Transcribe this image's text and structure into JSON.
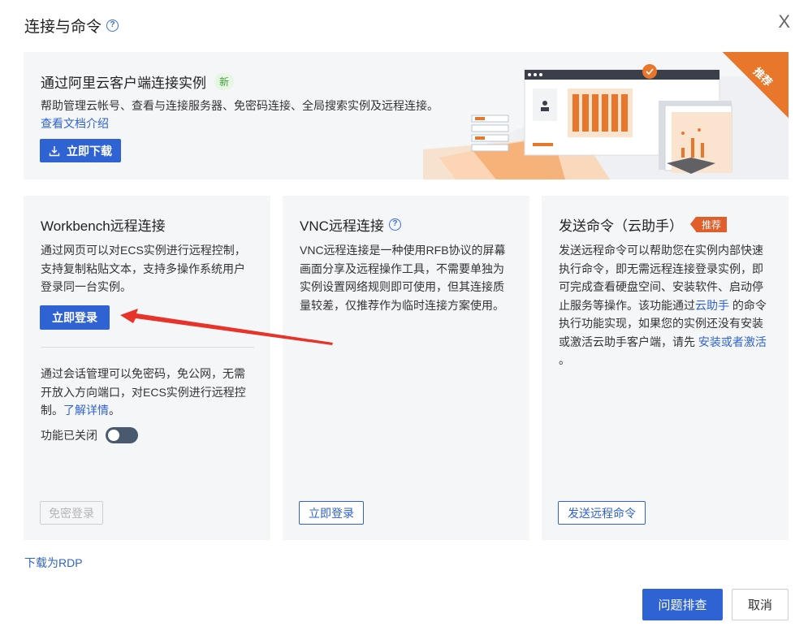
{
  "dialog": {
    "title": "连接与命令",
    "close_glyph": "X"
  },
  "banner": {
    "title": "通过阿里云客户端连接实例",
    "badge": "新",
    "description": "帮助管理云帐号、查看与连接服务器、免密码连接、全局搜索实例及远程连接。",
    "doc_link": "查看文档介绍",
    "download_button": "立即下载",
    "ribbon": "推荐"
  },
  "workbench": {
    "title": "Workbench远程连接",
    "description": "通过网页可以对ECS实例进行远程控制，支持复制粘贴文本，支持多操作系统用户登录同一台实例。",
    "login_button": "立即登录",
    "session_text": "通过会话管理可以免密码，免公网，无需开放入方向端口，对ECS实例进行远程控制。",
    "session_link": "了解详情",
    "session_suffix": "。",
    "toggle_label": "功能已关闭",
    "toggle_on": false,
    "passwordless_button": "免密登录"
  },
  "vnc": {
    "title": "VNC远程连接",
    "description": "VNC远程连接是一种使用RFB协议的屏幕画面分享及远程操作工具，不需要单独为实例设置网络规则即可使用，但其连接质量较差，仅推荐作为临时连接方案使用。",
    "login_button": "立即登录"
  },
  "command": {
    "title": "发送命令（云助手）",
    "badge": "推荐",
    "description_1": "发送远程命令可以帮助您在实例内部快速执行命令，即无需远程连接登录实例，即可完成查看硬盘空间、安装软件、启动停止服务等操作。该功能通过",
    "link_1": "云助手",
    "description_2": " 的命令执行功能实现，如果您的实例还没有安装或激活云助手客户端，请先 ",
    "link_2": "安装或者激活",
    "description_3": " 。",
    "send_button": "发送远程命令"
  },
  "footer": {
    "rdp_link": "下载为RDP",
    "troubleshoot_button": "问题排查",
    "cancel_button": "取消"
  },
  "colors": {
    "primary": "#2f62d3",
    "card_bg": "#f5f6f8",
    "accent_orange": "#e8772b",
    "arrow_red": "#e8332a"
  }
}
